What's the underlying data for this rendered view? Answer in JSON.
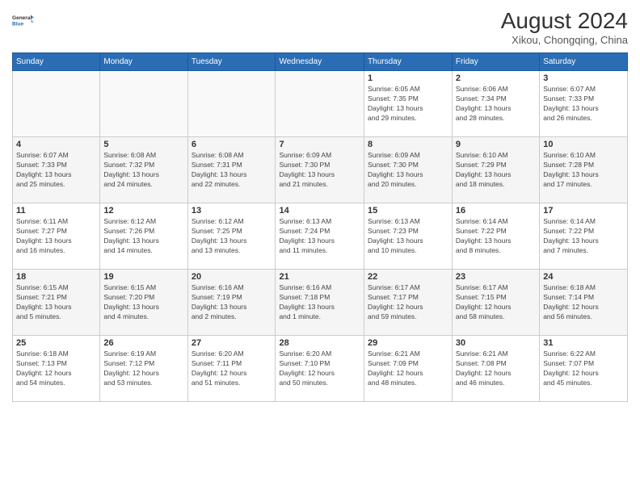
{
  "logo": {
    "line1": "General",
    "line2": "Blue"
  },
  "title": "August 2024",
  "location": "Xikou, Chongqing, China",
  "days_of_week": [
    "Sunday",
    "Monday",
    "Tuesday",
    "Wednesday",
    "Thursday",
    "Friday",
    "Saturday"
  ],
  "weeks": [
    [
      {
        "num": "",
        "info": ""
      },
      {
        "num": "",
        "info": ""
      },
      {
        "num": "",
        "info": ""
      },
      {
        "num": "",
        "info": ""
      },
      {
        "num": "1",
        "info": "Sunrise: 6:05 AM\nSunset: 7:35 PM\nDaylight: 13 hours\nand 29 minutes."
      },
      {
        "num": "2",
        "info": "Sunrise: 6:06 AM\nSunset: 7:34 PM\nDaylight: 13 hours\nand 28 minutes."
      },
      {
        "num": "3",
        "info": "Sunrise: 6:07 AM\nSunset: 7:33 PM\nDaylight: 13 hours\nand 26 minutes."
      }
    ],
    [
      {
        "num": "4",
        "info": "Sunrise: 6:07 AM\nSunset: 7:33 PM\nDaylight: 13 hours\nand 25 minutes."
      },
      {
        "num": "5",
        "info": "Sunrise: 6:08 AM\nSunset: 7:32 PM\nDaylight: 13 hours\nand 24 minutes."
      },
      {
        "num": "6",
        "info": "Sunrise: 6:08 AM\nSunset: 7:31 PM\nDaylight: 13 hours\nand 22 minutes."
      },
      {
        "num": "7",
        "info": "Sunrise: 6:09 AM\nSunset: 7:30 PM\nDaylight: 13 hours\nand 21 minutes."
      },
      {
        "num": "8",
        "info": "Sunrise: 6:09 AM\nSunset: 7:30 PM\nDaylight: 13 hours\nand 20 minutes."
      },
      {
        "num": "9",
        "info": "Sunrise: 6:10 AM\nSunset: 7:29 PM\nDaylight: 13 hours\nand 18 minutes."
      },
      {
        "num": "10",
        "info": "Sunrise: 6:10 AM\nSunset: 7:28 PM\nDaylight: 13 hours\nand 17 minutes."
      }
    ],
    [
      {
        "num": "11",
        "info": "Sunrise: 6:11 AM\nSunset: 7:27 PM\nDaylight: 13 hours\nand 16 minutes."
      },
      {
        "num": "12",
        "info": "Sunrise: 6:12 AM\nSunset: 7:26 PM\nDaylight: 13 hours\nand 14 minutes."
      },
      {
        "num": "13",
        "info": "Sunrise: 6:12 AM\nSunset: 7:25 PM\nDaylight: 13 hours\nand 13 minutes."
      },
      {
        "num": "14",
        "info": "Sunrise: 6:13 AM\nSunset: 7:24 PM\nDaylight: 13 hours\nand 11 minutes."
      },
      {
        "num": "15",
        "info": "Sunrise: 6:13 AM\nSunset: 7:23 PM\nDaylight: 13 hours\nand 10 minutes."
      },
      {
        "num": "16",
        "info": "Sunrise: 6:14 AM\nSunset: 7:22 PM\nDaylight: 13 hours\nand 8 minutes."
      },
      {
        "num": "17",
        "info": "Sunrise: 6:14 AM\nSunset: 7:22 PM\nDaylight: 13 hours\nand 7 minutes."
      }
    ],
    [
      {
        "num": "18",
        "info": "Sunrise: 6:15 AM\nSunset: 7:21 PM\nDaylight: 13 hours\nand 5 minutes."
      },
      {
        "num": "19",
        "info": "Sunrise: 6:15 AM\nSunset: 7:20 PM\nDaylight: 13 hours\nand 4 minutes."
      },
      {
        "num": "20",
        "info": "Sunrise: 6:16 AM\nSunset: 7:19 PM\nDaylight: 13 hours\nand 2 minutes."
      },
      {
        "num": "21",
        "info": "Sunrise: 6:16 AM\nSunset: 7:18 PM\nDaylight: 13 hours\nand 1 minute."
      },
      {
        "num": "22",
        "info": "Sunrise: 6:17 AM\nSunset: 7:17 PM\nDaylight: 12 hours\nand 59 minutes."
      },
      {
        "num": "23",
        "info": "Sunrise: 6:17 AM\nSunset: 7:15 PM\nDaylight: 12 hours\nand 58 minutes."
      },
      {
        "num": "24",
        "info": "Sunrise: 6:18 AM\nSunset: 7:14 PM\nDaylight: 12 hours\nand 56 minutes."
      }
    ],
    [
      {
        "num": "25",
        "info": "Sunrise: 6:18 AM\nSunset: 7:13 PM\nDaylight: 12 hours\nand 54 minutes."
      },
      {
        "num": "26",
        "info": "Sunrise: 6:19 AM\nSunset: 7:12 PM\nDaylight: 12 hours\nand 53 minutes."
      },
      {
        "num": "27",
        "info": "Sunrise: 6:20 AM\nSunset: 7:11 PM\nDaylight: 12 hours\nand 51 minutes."
      },
      {
        "num": "28",
        "info": "Sunrise: 6:20 AM\nSunset: 7:10 PM\nDaylight: 12 hours\nand 50 minutes."
      },
      {
        "num": "29",
        "info": "Sunrise: 6:21 AM\nSunset: 7:09 PM\nDaylight: 12 hours\nand 48 minutes."
      },
      {
        "num": "30",
        "info": "Sunrise: 6:21 AM\nSunset: 7:08 PM\nDaylight: 12 hours\nand 46 minutes."
      },
      {
        "num": "31",
        "info": "Sunrise: 6:22 AM\nSunset: 7:07 PM\nDaylight: 12 hours\nand 45 minutes."
      }
    ]
  ]
}
